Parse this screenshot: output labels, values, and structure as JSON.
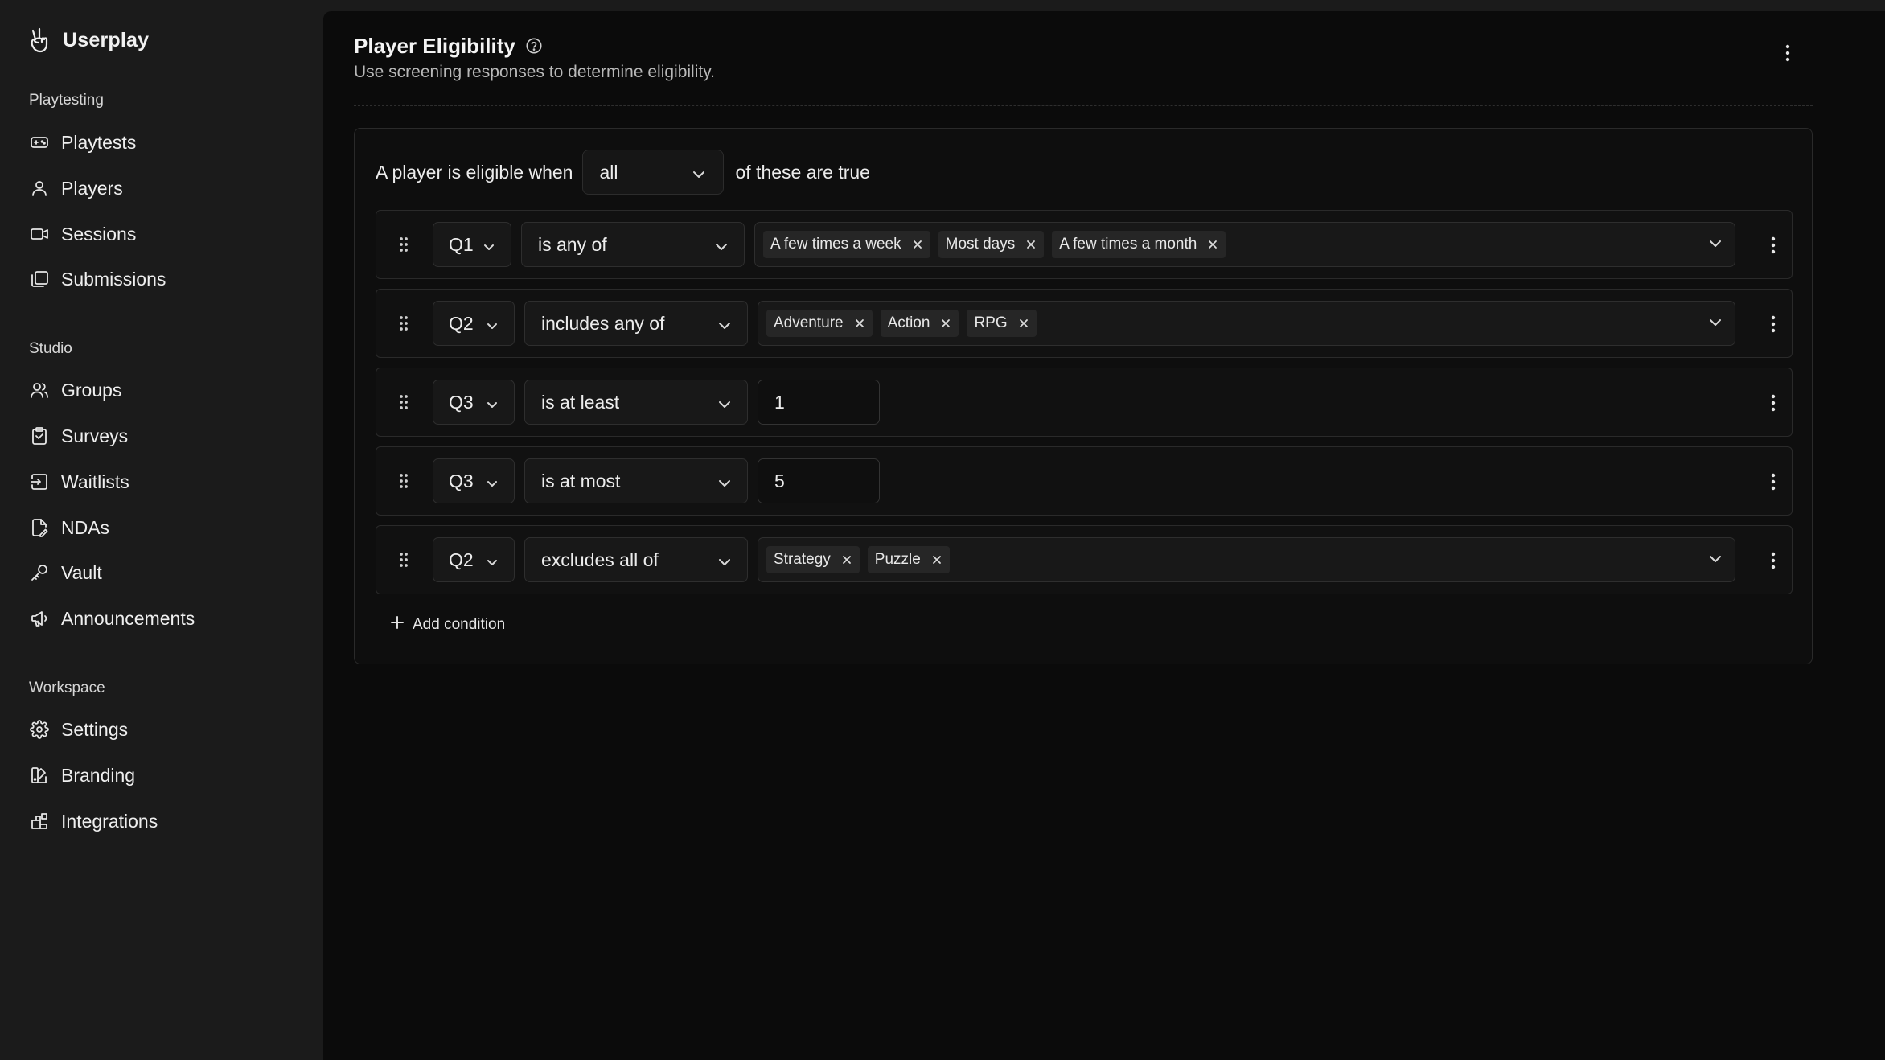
{
  "app": {
    "name": "Userplay",
    "logo_icon": "hand-peace-icon"
  },
  "sidebar": {
    "sections": [
      {
        "label": "Playtesting",
        "items": [
          {
            "label": "Playtests",
            "icon": "gamepad-icon"
          },
          {
            "label": "Players",
            "icon": "user-icon"
          },
          {
            "label": "Sessions",
            "icon": "video-camera-icon"
          },
          {
            "label": "Submissions",
            "icon": "stacked-cards-icon"
          }
        ]
      },
      {
        "label": "Studio",
        "items": [
          {
            "label": "Groups",
            "icon": "users-icon"
          },
          {
            "label": "Surveys",
            "icon": "clipboard-icon"
          },
          {
            "label": "Waitlists",
            "icon": "inbox-arrow-icon"
          },
          {
            "label": "NDAs",
            "icon": "file-pen-icon"
          },
          {
            "label": "Vault",
            "icon": "key-icon"
          },
          {
            "label": "Announcements",
            "icon": "megaphone-icon"
          }
        ]
      },
      {
        "label": "Workspace",
        "items": [
          {
            "label": "Settings",
            "icon": "gear-icon"
          },
          {
            "label": "Branding",
            "icon": "palette-icon"
          },
          {
            "label": "Integrations",
            "icon": "blocks-icon"
          }
        ]
      }
    ]
  },
  "page": {
    "title": "Player Eligibility",
    "title_icon": "help-circle-icon",
    "subtitle": "Use screening responses to determine eligibility.",
    "menu_icon": "more-vertical-icon"
  },
  "rules": {
    "prefix": "A player is eligible when",
    "mode": "all",
    "suffix": "of these are true",
    "conditions": [
      {
        "question": "Q1",
        "operator": "is any of",
        "values": [
          "A few times a week",
          "Most days",
          "A few times a month"
        ]
      },
      {
        "question": "Q2",
        "operator": "includes any of",
        "values": [
          "Adventure",
          "Action",
          "RPG"
        ]
      },
      {
        "question": "Q3",
        "operator": "is at least",
        "value": "1"
      },
      {
        "question": "Q3",
        "operator": "is at most",
        "value": "5"
      },
      {
        "question": "Q2",
        "operator": "excludes all of",
        "values": [
          "Strategy",
          "Puzzle"
        ]
      }
    ],
    "add_label": "Add condition"
  }
}
